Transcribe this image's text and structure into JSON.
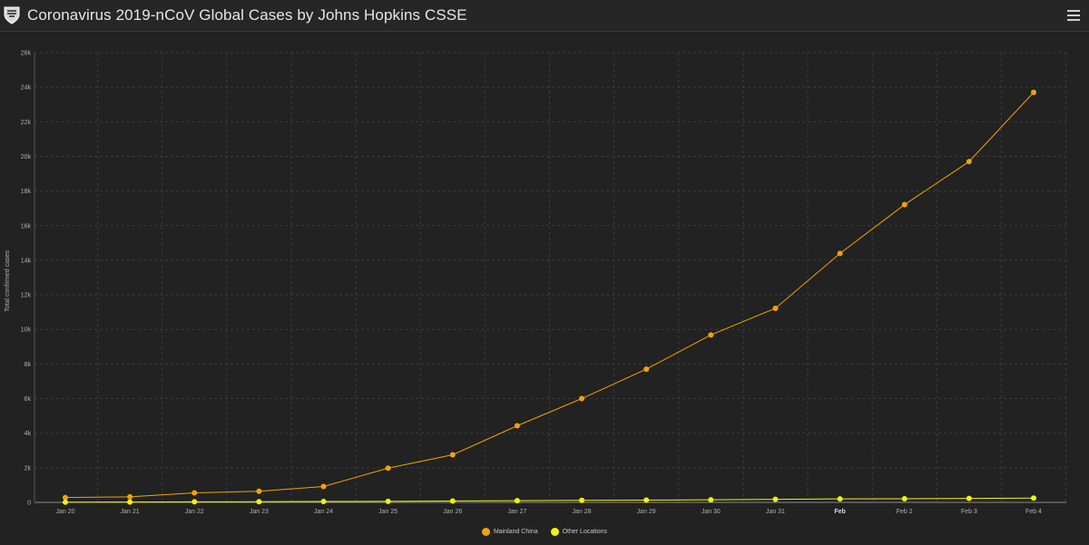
{
  "header": {
    "title": "Coronavirus 2019-nCoV Global Cases by Johns Hopkins CSSE",
    "logo_icon": "jhu-shield-icon",
    "menu_icon": "hamburger-menu-icon",
    "expand_icon": "expand-icon"
  },
  "colors": {
    "background": "#222222",
    "grid": "#3a3a3a",
    "mainland": "#f0a30a",
    "other": "#f3f30a",
    "axis_text": "#b0b0b0"
  },
  "chart_data": {
    "type": "line",
    "title": "",
    "xlabel": "",
    "ylabel": "Total confirmed cases",
    "categories": [
      "Jan 20",
      "Jan 21",
      "Jan 22",
      "Jan 23",
      "Jan 24",
      "Jan 25",
      "Jan 26",
      "Jan 27",
      "Jan 28",
      "Jan 29",
      "Jan 30",
      "Jan 31",
      "Feb",
      "Feb 2",
      "Feb 3",
      "Feb 4"
    ],
    "bold_categories": [
      "Feb"
    ],
    "ylim": [
      0,
      26000
    ],
    "yticks": [
      0,
      2000,
      4000,
      6000,
      8000,
      10000,
      12000,
      14000,
      16000,
      18000,
      20000,
      22000,
      24000,
      26000
    ],
    "ytick_labels": [
      "0",
      "2k",
      "4k",
      "6k",
      "8k",
      "10k",
      "12k",
      "14k",
      "16k",
      "18k",
      "20k",
      "22k",
      "24k",
      "26k"
    ],
    "grid": true,
    "legend_position": "bottom-center",
    "series": [
      {
        "name": "Mainland China",
        "color": "#f0a30a",
        "values": [
          280,
          320,
          550,
          640,
          920,
          1980,
          2750,
          4430,
          6000,
          7700,
          9680,
          11220,
          14390,
          17210,
          19700,
          23700
        ]
      },
      {
        "name": "Other Locations",
        "color": "#f3f30a",
        "values": [
          10,
          20,
          30,
          40,
          50,
          60,
          80,
          100,
          120,
          130,
          150,
          180,
          200,
          210,
          230,
          250
        ]
      }
    ]
  }
}
